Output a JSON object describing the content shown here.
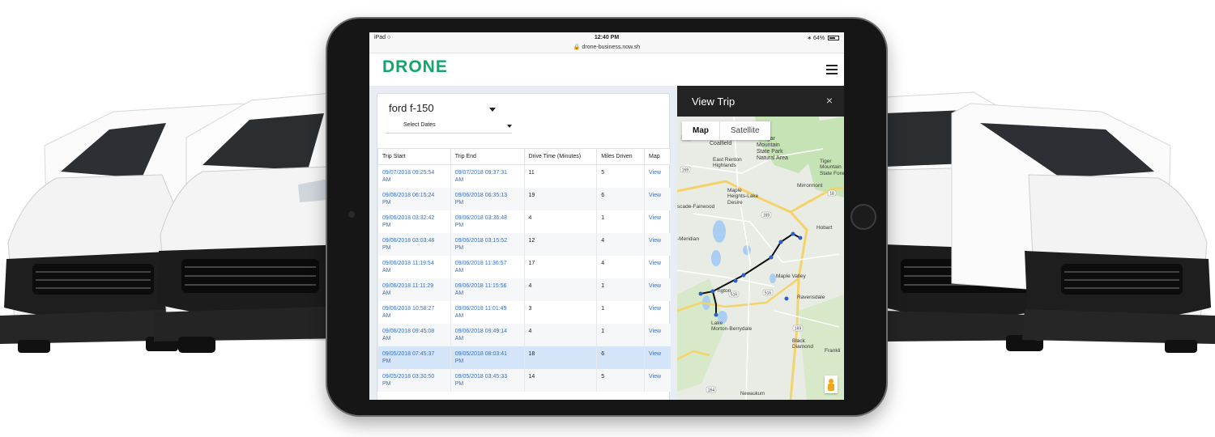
{
  "status_bar": {
    "device": "iPad",
    "time": "12:40 PM",
    "url": "drone-business.now.sh",
    "battery": "64%"
  },
  "app": {
    "logo": "DRONE"
  },
  "filters": {
    "vehicle": "ford f-150",
    "dates": "Select Dates"
  },
  "table": {
    "headers": [
      "Trip Start",
      "Trip End",
      "Drive Time (Minutes)",
      "Miles Driven",
      "Map"
    ],
    "rows": [
      {
        "start": [
          "09/07/2018 09:25:54",
          "AM"
        ],
        "end": [
          "09/07/2018 09:37:31",
          "AM"
        ],
        "drive": "11",
        "miles": "5",
        "map": "View"
      },
      {
        "start": [
          "09/06/2018 06:15:24",
          "PM"
        ],
        "end": [
          "09/06/2018 06:35:13",
          "PM"
        ],
        "drive": "19",
        "miles": "6",
        "map": "View"
      },
      {
        "start": [
          "09/06/2018 03:32:42",
          "PM"
        ],
        "end": [
          "09/06/2018 03:36:48",
          "PM"
        ],
        "drive": "4",
        "miles": "1",
        "map": "View"
      },
      {
        "start": [
          "09/06/2018 03:03:48",
          "PM"
        ],
        "end": [
          "09/06/2018 03:15:52",
          "PM"
        ],
        "drive": "12",
        "miles": "4",
        "map": "View"
      },
      {
        "start": [
          "09/06/2018 11:19:54",
          "AM"
        ],
        "end": [
          "09/06/2018 11:36:57",
          "AM"
        ],
        "drive": "17",
        "miles": "4",
        "map": "View"
      },
      {
        "start": [
          "09/06/2018 11:11:29",
          "AM"
        ],
        "end": [
          "09/06/2018 11:15:56",
          "AM"
        ],
        "drive": "4",
        "miles": "1",
        "map": "View"
      },
      {
        "start": [
          "09/06/2018 10:58:27",
          "AM"
        ],
        "end": [
          "09/06/2018 11:01:49",
          "AM"
        ],
        "drive": "3",
        "miles": "1",
        "map": "View"
      },
      {
        "start": [
          "09/06/2018 09:45:08",
          "AM"
        ],
        "end": [
          "09/06/2018 09:49:14",
          "AM"
        ],
        "drive": "4",
        "miles": "1",
        "map": "View"
      },
      {
        "start": [
          "09/05/2018 07:45:37",
          "PM"
        ],
        "end": [
          "09/05/2018 08:03:41",
          "PM"
        ],
        "drive": "18",
        "miles": "6",
        "map": "View"
      },
      {
        "start": [
          "09/05/2018 03:30:50",
          "PM"
        ],
        "end": [
          "09/05/2018 03:45:33",
          "PM"
        ],
        "drive": "14",
        "miles": "5",
        "map": "View"
      }
    ],
    "selected_row_index": 8
  },
  "view_trip": {
    "title": "View Trip",
    "close_glyph": "×",
    "map_tabs": [
      "Map",
      "Satellite"
    ],
    "active_tab": "Map"
  },
  "map_labels": {
    "coalfield": "Coalfield",
    "cougar": "Cougar\nMountain\nState Park\nNatural Area",
    "east_renton": "East Renton\nHighlands",
    "tiger": "Tiger\nMountain\nState Forest",
    "mirrormont": "Mirrormont",
    "maple_heights": "Maple\nHeights-Lake\nDesire",
    "cascade_fairwood": "scade-Fairwood",
    "hobart": "Hobart",
    "meridian": "-Meridian",
    "maple_valley": "Maple Valley",
    "covington": "ngton",
    "ravensdale": "Ravensdale",
    "morton": "Lake\nMorton-Berrydale",
    "black_diamond": "Black\nDiamond",
    "franklin": "Frankli",
    "newaukum": "Newaukum",
    "route_900": "900",
    "route_169a": "169",
    "route_18a": "18",
    "route_516a": "516",
    "route_516b": "516",
    "route_169b": "169",
    "route_169c": "169",
    "route_164": "164"
  },
  "colors": {
    "brand": "#10a66c",
    "link": "#3a6fc4",
    "selected_row": "#d4e5fa",
    "route": "#111111",
    "park": "#c5e3b4",
    "water": "#a9cdf3",
    "highway": "#f5d36b"
  }
}
